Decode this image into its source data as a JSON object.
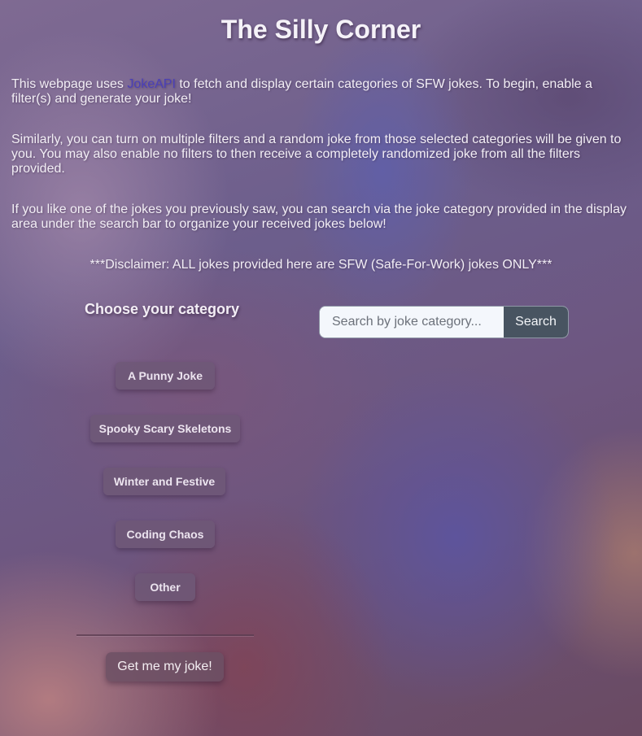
{
  "page": {
    "title": "The Silly Corner"
  },
  "intro": {
    "p1_before": "This webpage uses ",
    "p1_link": "JokeAPI",
    "p1_after": " to fetch and display certain categories of SFW jokes. To begin, enable a filter(s) and generate your joke!",
    "p2": "Similarly, you can turn on multiple filters and a random joke from those selected categories will be given to you. You may also enable no filters to then receive a completely randomized joke from all the filters provided.",
    "p3": "If you like one of the jokes you previously saw, you can search via the joke category provided in the display area under the search bar to organize your received jokes below!",
    "disclaimer": "***Disclaimer: ALL jokes provided here are SFW (Safe-For-Work) jokes ONLY***"
  },
  "categories": {
    "heading": "Choose your category",
    "items": [
      {
        "label": "A Punny Joke"
      },
      {
        "label": "Spooky Scary Skeletons"
      },
      {
        "label": "Winter and Festive"
      },
      {
        "label": "Coding Chaos"
      },
      {
        "label": "Other"
      }
    ],
    "submit_label": "Get me my joke!"
  },
  "search": {
    "placeholder": "Search by joke category...",
    "value": "",
    "button_label": "Search"
  },
  "colors": {
    "link": "#4a3fb8",
    "search_button": "#485461",
    "category_button": "#6e5876"
  }
}
